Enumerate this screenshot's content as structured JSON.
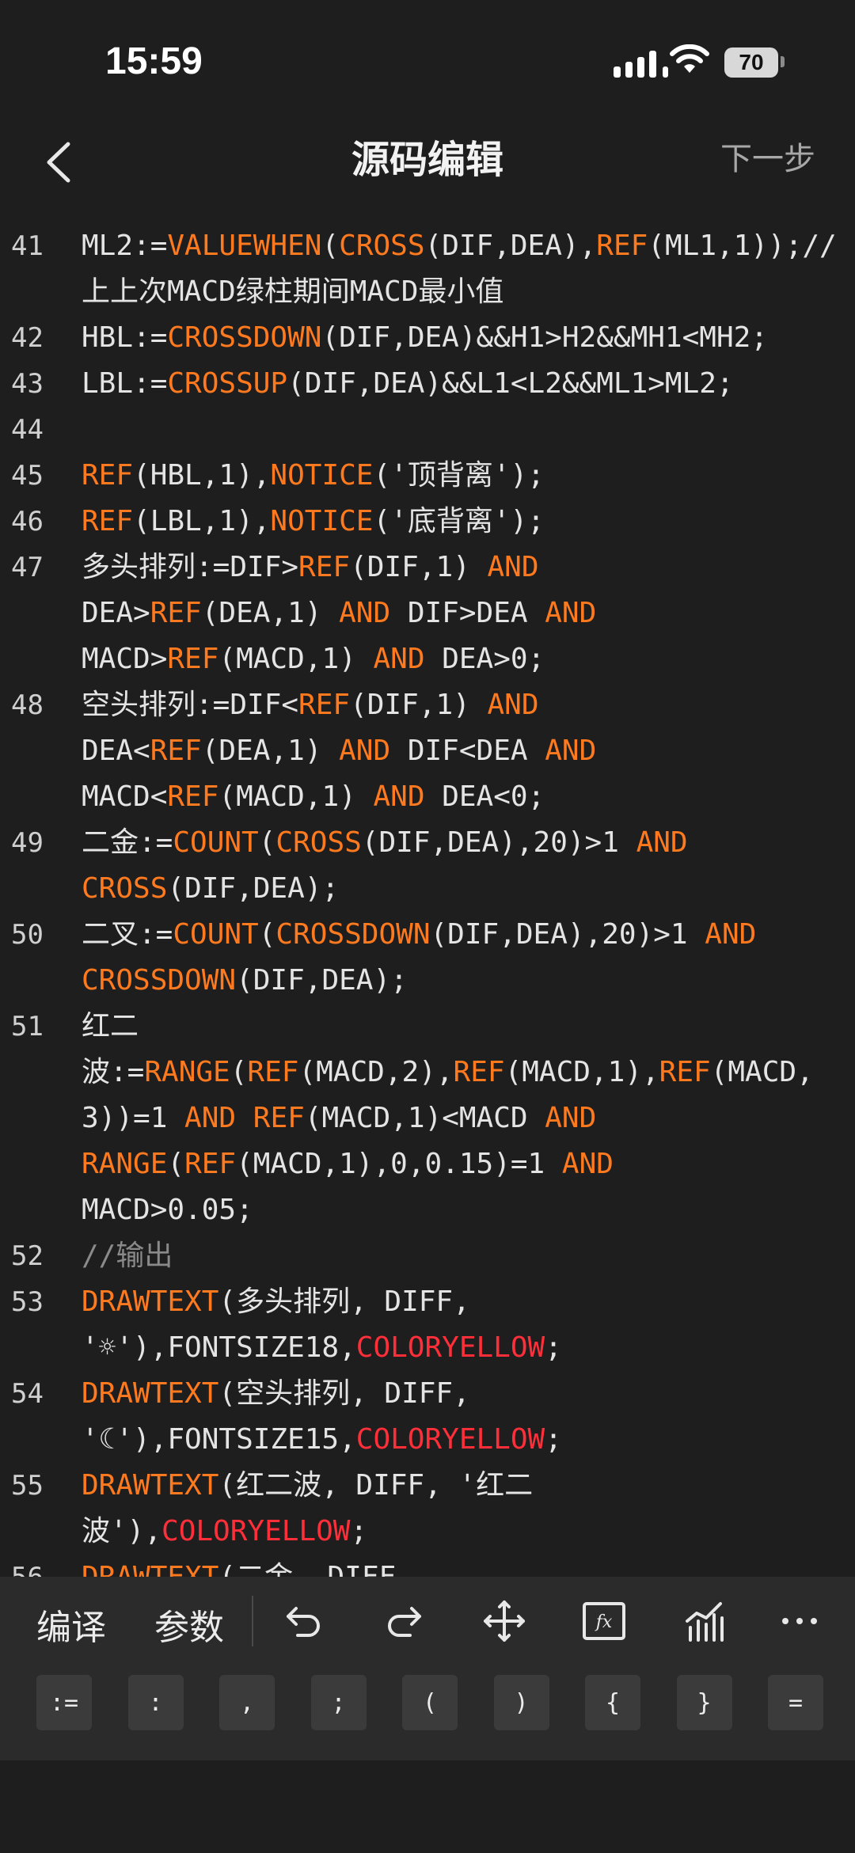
{
  "status": {
    "time": "15:59",
    "battery": "70"
  },
  "nav": {
    "title": "源码编辑",
    "next": "下一步"
  },
  "code": [
    {
      "n": "41",
      "segs": [
        [
          "t",
          "ML2:="
        ],
        [
          "k",
          "VALUEWHEN"
        ],
        [
          "t",
          "("
        ],
        [
          "k",
          "CROSS"
        ],
        [
          "t",
          "(DIF,DEA),"
        ],
        [
          "k",
          "REF"
        ],
        [
          "t",
          "(ML1,1));//上上次MACD绿柱期间MACD最小值"
        ]
      ]
    },
    {
      "n": "42",
      "segs": [
        [
          "t",
          "HBL:="
        ],
        [
          "k",
          "CROSSDOWN"
        ],
        [
          "t",
          "(DIF,DEA)&&H1>H2&&MH1<MH2;"
        ]
      ]
    },
    {
      "n": "43",
      "segs": [
        [
          "t",
          "LBL:="
        ],
        [
          "k",
          "CROSSUP"
        ],
        [
          "t",
          "(DIF,DEA)&&L1<L2&&ML1>ML2;"
        ]
      ]
    },
    {
      "n": "44",
      "segs": [
        [
          "t",
          " "
        ]
      ]
    },
    {
      "n": "45",
      "segs": [
        [
          "k",
          "REF"
        ],
        [
          "t",
          "(HBL,1),"
        ],
        [
          "k",
          "NOTICE"
        ],
        [
          "t",
          "('顶背离');"
        ]
      ]
    },
    {
      "n": "46",
      "segs": [
        [
          "k",
          "REF"
        ],
        [
          "t",
          "(LBL,1),"
        ],
        [
          "k",
          "NOTICE"
        ],
        [
          "t",
          "('底背离');"
        ]
      ]
    },
    {
      "n": "47",
      "segs": [
        [
          "t",
          "多头排列:=DIF>"
        ],
        [
          "k",
          "REF"
        ],
        [
          "t",
          "(DIF,1) "
        ],
        [
          "k",
          "AND"
        ],
        [
          "t",
          "\nDEA>"
        ],
        [
          "k",
          "REF"
        ],
        [
          "t",
          "(DEA,1) "
        ],
        [
          "k",
          "AND"
        ],
        [
          "t",
          " DIF>DEA "
        ],
        [
          "k",
          "AND"
        ],
        [
          "t",
          "\nMACD>"
        ],
        [
          "k",
          "REF"
        ],
        [
          "t",
          "(MACD,1) "
        ],
        [
          "k",
          "AND"
        ],
        [
          "t",
          " DEA>0;"
        ]
      ]
    },
    {
      "n": "48",
      "segs": [
        [
          "t",
          "空头排列:=DIF<"
        ],
        [
          "k",
          "REF"
        ],
        [
          "t",
          "(DIF,1) "
        ],
        [
          "k",
          "AND"
        ],
        [
          "t",
          "\nDEA<"
        ],
        [
          "k",
          "REF"
        ],
        [
          "t",
          "(DEA,1) "
        ],
        [
          "k",
          "AND"
        ],
        [
          "t",
          " DIF<DEA "
        ],
        [
          "k",
          "AND"
        ],
        [
          "t",
          "\nMACD<"
        ],
        [
          "k",
          "REF"
        ],
        [
          "t",
          "(MACD,1) "
        ],
        [
          "k",
          "AND"
        ],
        [
          "t",
          " DEA<0;"
        ]
      ]
    },
    {
      "n": "49",
      "segs": [
        [
          "t",
          "二金:="
        ],
        [
          "k",
          "COUNT"
        ],
        [
          "t",
          "("
        ],
        [
          "k",
          "CROSS"
        ],
        [
          "t",
          "(DIF,DEA),20)>1 "
        ],
        [
          "k",
          "AND"
        ],
        [
          "t",
          "\n"
        ],
        [
          "k",
          "CROSS"
        ],
        [
          "t",
          "(DIF,DEA);"
        ]
      ]
    },
    {
      "n": "50",
      "segs": [
        [
          "t",
          "二叉:="
        ],
        [
          "k",
          "COUNT"
        ],
        [
          "t",
          "("
        ],
        [
          "k",
          "CROSSDOWN"
        ],
        [
          "t",
          "(DIF,DEA),20)>1 "
        ],
        [
          "k",
          "AND"
        ],
        [
          "t",
          "\n"
        ],
        [
          "k",
          "CROSSDOWN"
        ],
        [
          "t",
          "(DIF,DEA);"
        ]
      ]
    },
    {
      "n": "51",
      "segs": [
        [
          "t",
          "红二\n波:="
        ],
        [
          "k",
          "RANGE"
        ],
        [
          "t",
          "("
        ],
        [
          "k",
          "REF"
        ],
        [
          "t",
          "(MACD,2),"
        ],
        [
          "k",
          "REF"
        ],
        [
          "t",
          "(MACD,1),"
        ],
        [
          "k",
          "REF"
        ],
        [
          "t",
          "(MACD,3))=1 "
        ],
        [
          "k",
          "AND"
        ],
        [
          "t",
          " "
        ],
        [
          "k",
          "REF"
        ],
        [
          "t",
          "(MACD,1)<MACD "
        ],
        [
          "k",
          "AND"
        ],
        [
          "t",
          "\n"
        ],
        [
          "k",
          "RANGE"
        ],
        [
          "t",
          "("
        ],
        [
          "k",
          "REF"
        ],
        [
          "t",
          "(MACD,1),0,0.15)=1 "
        ],
        [
          "k",
          "AND"
        ],
        [
          "t",
          "\nMACD>0.05;"
        ]
      ]
    },
    {
      "n": "52",
      "segs": [
        [
          "c",
          "//输出"
        ]
      ]
    },
    {
      "n": "53",
      "segs": [
        [
          "k",
          "DRAWTEXT"
        ],
        [
          "t",
          "(多头排列, DIFF,\n'☼'),FONTSIZE18,"
        ],
        [
          "r",
          "COLORYELLOW"
        ],
        [
          "t",
          ";"
        ]
      ]
    },
    {
      "n": "54",
      "segs": [
        [
          "k",
          "DRAWTEXT"
        ],
        [
          "t",
          "(空头排列, DIFF,\n'☾'),FONTSIZE15,"
        ],
        [
          "r",
          "COLORYELLOW"
        ],
        [
          "t",
          ";"
        ]
      ]
    },
    {
      "n": "55",
      "segs": [
        [
          "k",
          "DRAWTEXT"
        ],
        [
          "t",
          "(红二波, DIFF, '红二\n波'),"
        ],
        [
          "r",
          "COLORYELLOW"
        ],
        [
          "t",
          ";"
        ]
      ]
    },
    {
      "n": "56",
      "segs": [
        [
          "k",
          "DRAWTEXT"
        ],
        [
          "t",
          "(二金, DIFF"
        ]
      ]
    }
  ],
  "toolbar": {
    "compile": "编译",
    "params": "参数"
  },
  "keys": [
    ":=",
    ":",
    ",",
    ";",
    "(",
    ")",
    "{",
    "}",
    "="
  ]
}
